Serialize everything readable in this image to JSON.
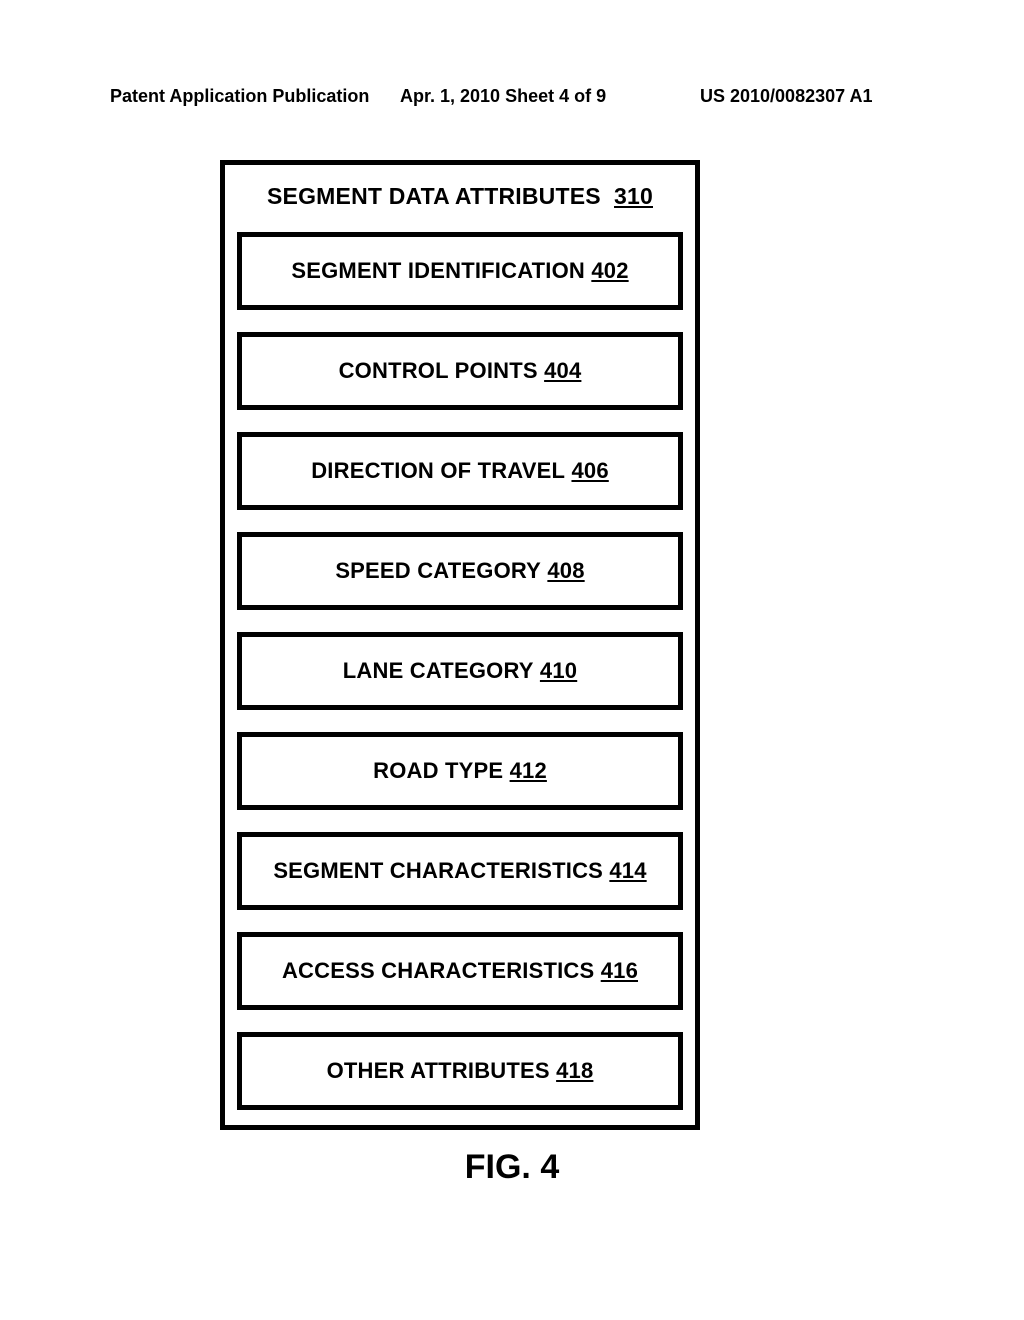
{
  "header": {
    "left": "Patent Application Publication",
    "center": "Apr. 1, 2010   Sheet 4 of 9",
    "right": "US 2010/0082307 A1"
  },
  "outer": {
    "title_text": "SEGMENT DATA ATTRIBUTES",
    "title_ref": "310"
  },
  "attributes": [
    {
      "label": "SEGMENT IDENTIFICATION",
      "ref": "402"
    },
    {
      "label": "CONTROL POINTS",
      "ref": "404"
    },
    {
      "label": "DIRECTION OF TRAVEL",
      "ref": "406"
    },
    {
      "label": "SPEED CATEGORY",
      "ref": "408"
    },
    {
      "label": "LANE CATEGORY",
      "ref": "410"
    },
    {
      "label": "ROAD TYPE",
      "ref": "412"
    },
    {
      "label": "SEGMENT CHARACTERISTICS",
      "ref": "414"
    },
    {
      "label": "ACCESS CHARACTERISTICS",
      "ref": "416"
    },
    {
      "label": "OTHER ATTRIBUTES",
      "ref": "418"
    }
  ],
  "caption": "FIG. 4"
}
